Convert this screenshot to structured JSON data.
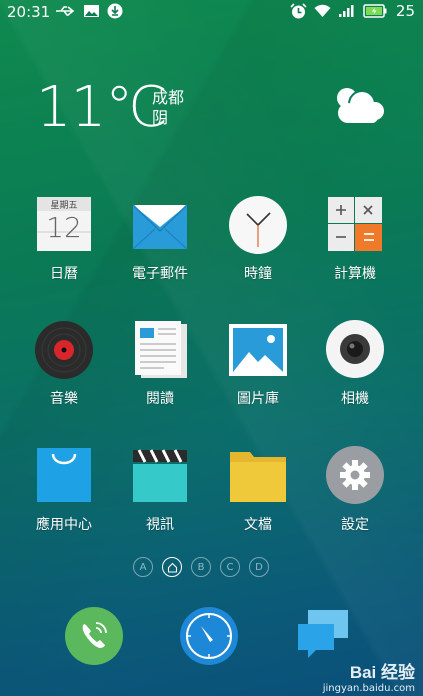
{
  "status_bar": {
    "time": "20:31",
    "battery_level": "25",
    "left_icons": [
      "usb-icon",
      "image-icon",
      "download-icon"
    ],
    "right_icons": [
      "alarm-icon",
      "wifi-icon",
      "signal-icon",
      "battery-icon"
    ]
  },
  "weather": {
    "temperature": "11℃",
    "city": "成都",
    "condition": "阴",
    "icon": "cloud-icon"
  },
  "calendar_icon": {
    "weekday": "星期五",
    "day": "12"
  },
  "apps": [
    {
      "label": "日曆",
      "icon": "calendar-icon"
    },
    {
      "label": "電子郵件",
      "icon": "email-icon"
    },
    {
      "label": "時鐘",
      "icon": "clock-icon"
    },
    {
      "label": "計算機",
      "icon": "calculator-icon"
    },
    {
      "label": "音樂",
      "icon": "music-icon"
    },
    {
      "label": "閱讀",
      "icon": "reader-icon"
    },
    {
      "label": "圖片庫",
      "icon": "gallery-icon"
    },
    {
      "label": "相機",
      "icon": "camera-icon"
    },
    {
      "label": "應用中心",
      "icon": "app-store-icon"
    },
    {
      "label": "視訊",
      "icon": "video-icon"
    },
    {
      "label": "文檔",
      "icon": "folder-icon"
    },
    {
      "label": "設定",
      "icon": "settings-icon"
    }
  ],
  "page_indicator": [
    "A",
    "home",
    "B",
    "C",
    "D"
  ],
  "dock": [
    "phone-icon",
    "browser-icon",
    "messages-icon"
  ],
  "watermark": {
    "logo": "Bai 经验",
    "url": "jingyan.baidu.com"
  },
  "colors": {
    "background_top": "#0f8a4e",
    "background_bottom": "#0a4f7a",
    "phone_green": "#5cb85c",
    "browser_blue": "#1e88d8",
    "orange": "#f07a2a"
  }
}
